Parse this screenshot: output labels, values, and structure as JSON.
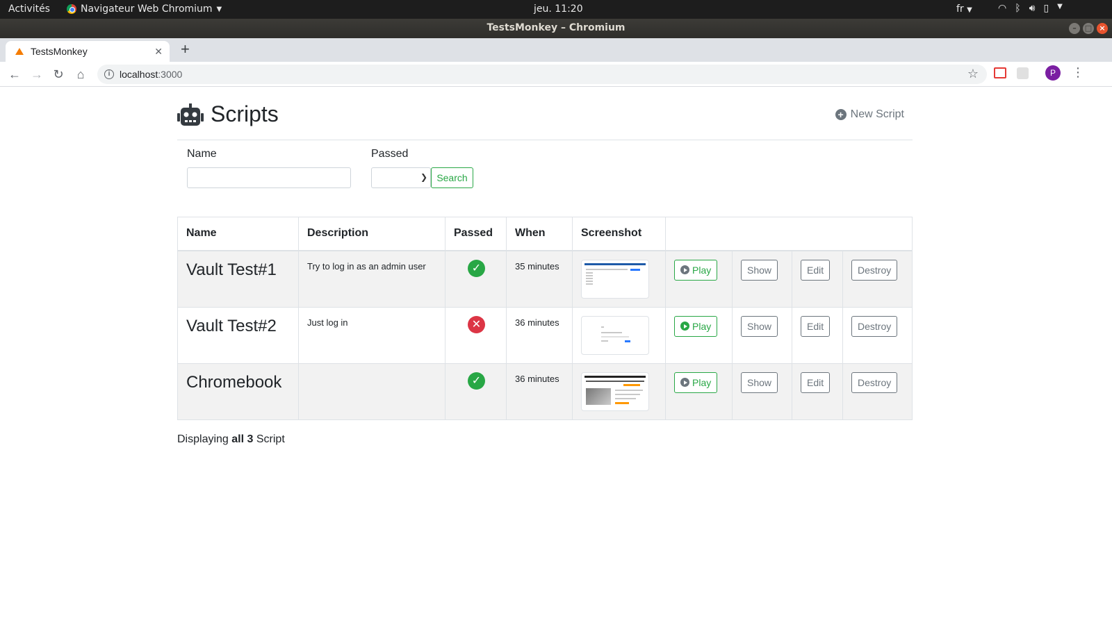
{
  "desktop": {
    "activities": "Activités",
    "app_menu": "Navigateur Web Chromium",
    "clock": "jeu. 11:20",
    "lang": "fr"
  },
  "window": {
    "title": "TestsMonkey – Chromium"
  },
  "browser": {
    "tab_title": "TestsMonkey",
    "url_host": "localhost",
    "url_port": ":3000",
    "avatar_letter": "P"
  },
  "page": {
    "title": "Scripts",
    "new_script_label": "New Script",
    "filter": {
      "name_label": "Name",
      "name_value": "",
      "passed_label": "Passed",
      "passed_value": "",
      "search_label": "Search"
    },
    "table": {
      "headers": [
        "Name",
        "Description",
        "Passed",
        "When",
        "Screenshot",
        ""
      ],
      "rows": [
        {
          "name": "Vault Test#1",
          "description": "Try to log in as an admin user",
          "passed": true,
          "when": "35 minutes",
          "screenshot": "admin-page-thumbnail"
        },
        {
          "name": "Vault Test#2",
          "description": "Just log in",
          "passed": false,
          "when": "36 minutes",
          "screenshot": "login-form-thumbnail"
        },
        {
          "name": "Chromebook",
          "description": "",
          "passed": true,
          "when": "36 minutes",
          "screenshot": "product-page-thumbnail"
        }
      ],
      "actions": {
        "play": "Play",
        "show": "Show",
        "edit": "Edit",
        "destroy": "Destroy"
      }
    },
    "footer": {
      "prefix": "Displaying",
      "count": "all 3",
      "suffix": "Script"
    }
  },
  "colors": {
    "success": "#28a745",
    "danger": "#dc3545",
    "secondary": "#6c757d"
  }
}
